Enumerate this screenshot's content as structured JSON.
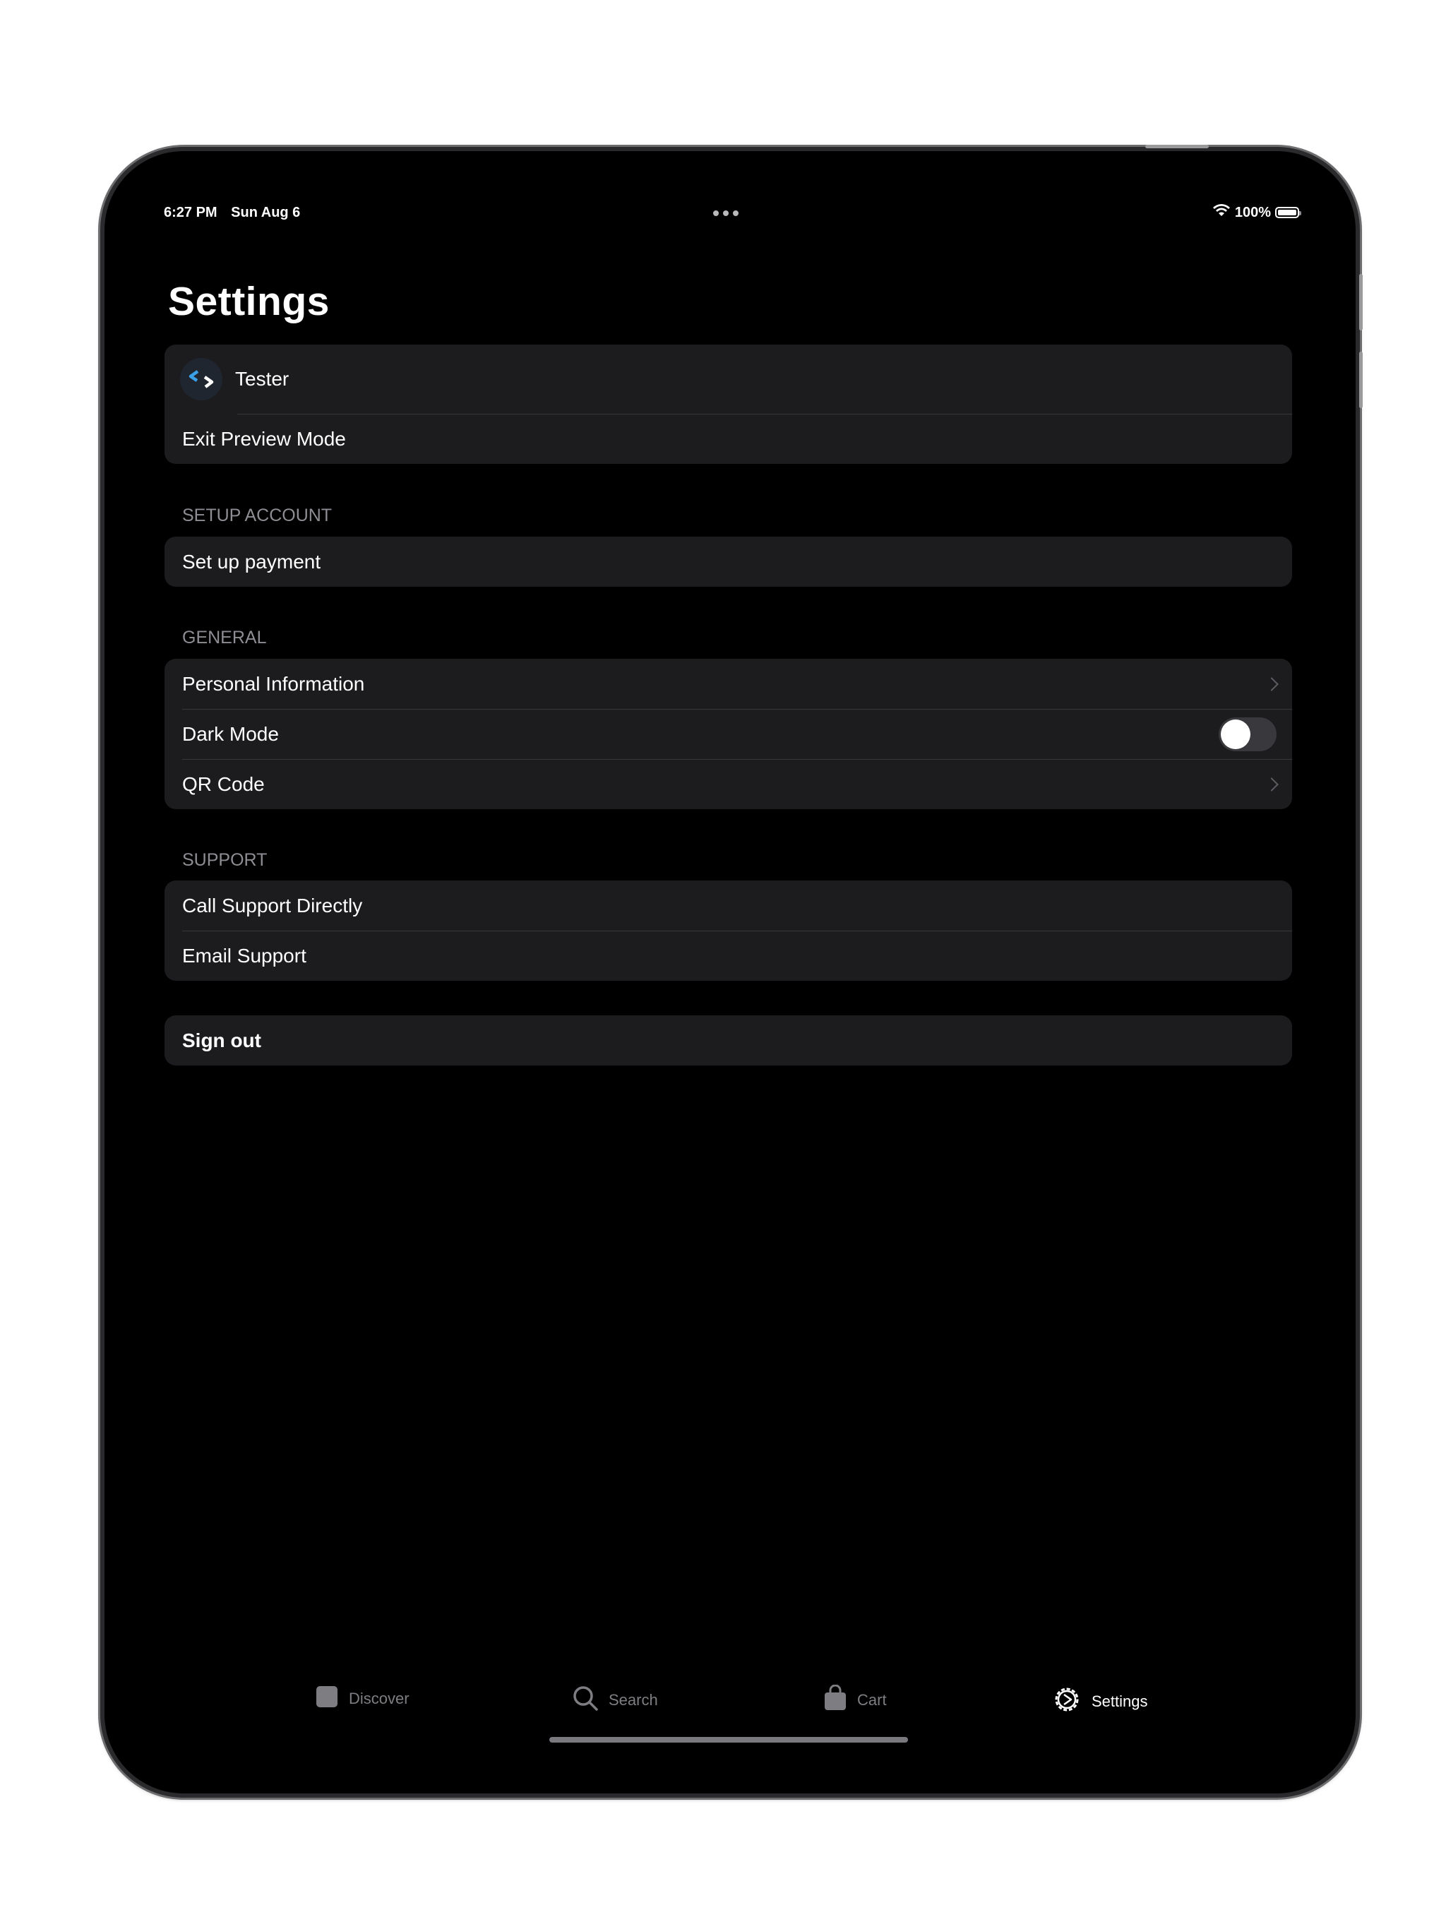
{
  "status_bar": {
    "time": "6:27 PM",
    "date": "Sun Aug 6",
    "battery": "100%",
    "battery_level": 1.0
  },
  "page": {
    "title": "Settings"
  },
  "account": {
    "name": "Tester",
    "exit_preview": "Exit Preview Mode"
  },
  "setup_account": {
    "header": "SETUP ACCOUNT",
    "items": [
      {
        "label": "Set up payment"
      }
    ]
  },
  "general": {
    "header": "GENERAL",
    "items": [
      {
        "label": "Personal Information"
      },
      {
        "label": "Dark Mode",
        "toggle_on": false
      },
      {
        "label": "QR Code"
      }
    ]
  },
  "support": {
    "header": "SUPPORT",
    "items": [
      {
        "label": "Call Support Directly"
      },
      {
        "label": "Email Support"
      }
    ]
  },
  "signout": {
    "label": "Sign out"
  },
  "tabbar": {
    "tabs": [
      {
        "label": "Discover",
        "icon": "square-icon",
        "active": false
      },
      {
        "label": "Search",
        "icon": "search-icon",
        "active": false
      },
      {
        "label": "Cart",
        "icon": "bag-icon",
        "active": false
      },
      {
        "label": "Settings",
        "icon": "gear-icon",
        "active": true
      }
    ]
  },
  "colors": {
    "background": "#000000",
    "cell": "#1c1c1e",
    "separator": "#38383a",
    "secondary_text": "#8d8d93",
    "inactive_tab": "#7d7d82",
    "logo_accent": "#3aa0e8"
  }
}
